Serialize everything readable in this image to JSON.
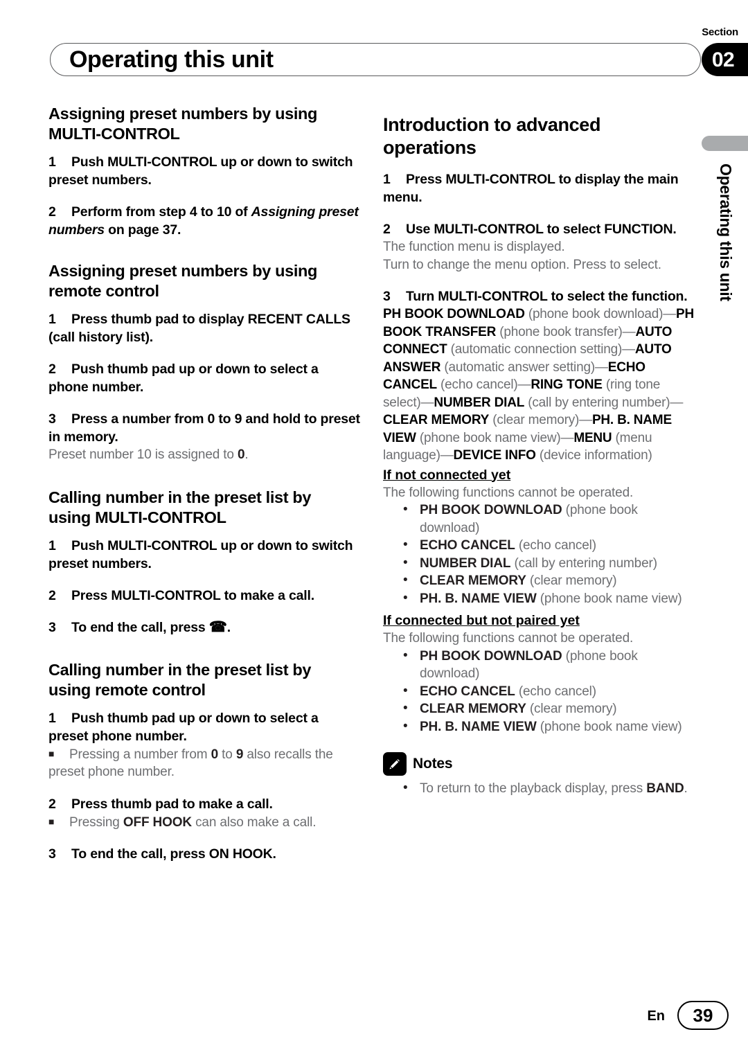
{
  "header": {
    "title": "Operating this unit",
    "section_label": "Section",
    "section_number": "02"
  },
  "thumb_tab": {
    "label": "Operating this unit",
    "color": "#a9abad"
  },
  "left_column": {
    "section1": {
      "heading_line1": "Assigning preset numbers by using",
      "heading_line2": "MULTI-CONTROL",
      "steps": [
        {
          "num": "1",
          "text": "Push MULTI-CONTROL up or down to switch preset numbers."
        },
        {
          "num": "2",
          "text_pre": "Perform from step 4 to 10 of ",
          "text_italic": "Assigning preset numbers",
          "text_post": " on page 37."
        }
      ]
    },
    "section2": {
      "heading_line1": "Assigning preset numbers by using",
      "heading_line2": "remote control",
      "steps": [
        {
          "num": "1",
          "text": "Press thumb pad to display RECENT CALLS (call history list)."
        },
        {
          "num": "2",
          "text": "Push thumb pad up or down to select a phone number."
        },
        {
          "num": "3",
          "text": "Press a number from 0 to 9 and hold to preset in memory."
        }
      ],
      "note_pre": "Preset number 10 is assigned to ",
      "note_bold": "0",
      "note_post": "."
    },
    "section3": {
      "heading_line1": "Calling number in the preset list by",
      "heading_line2_bold": "using ",
      "heading_line2_rest": "MULTI-CONTROL",
      "steps": [
        {
          "num": "1",
          "text": "Push MULTI-CONTROL up or down to switch preset numbers."
        },
        {
          "num": "2",
          "text": "Press MULTI-CONTROL to make a call."
        },
        {
          "num": "3",
          "text_pre": "To end the call, press ",
          "icon": "telephone-icon",
          "icon_glyph": "☎",
          "text_post": "."
        }
      ]
    },
    "section4": {
      "heading_line1": "Calling number in the preset list by",
      "heading_line2": "using remote control",
      "step1": {
        "num": "1",
        "text": "Push thumb pad up or down to select a preset phone number."
      },
      "step1_bullet_pre": "Pressing a number from ",
      "step1_bullet_b1": "0",
      "step1_bullet_mid": " to ",
      "step1_bullet_b2": "9",
      "step1_bullet_post": " also recalls the preset phone number.",
      "step2": {
        "num": "2",
        "text": "Press thumb pad to make a call."
      },
      "step2_bullet_pre": "Pressing ",
      "step2_bullet_bold": "OFF HOOK",
      "step2_bullet_post": " can also make a call.",
      "step3": {
        "num": "3",
        "text": "To end the call, press ON HOOK."
      }
    }
  },
  "right_column": {
    "heading_line1": "Introduction to advanced",
    "heading_line2": "operations",
    "step1": {
      "num": "1",
      "text": "Press MULTI-CONTROL to display the main menu."
    },
    "step2": {
      "num": "2",
      "text": "Use MULTI-CONTROL to select FUNCTION."
    },
    "step2_notes": [
      "The function menu is displayed.",
      "Turn to change the menu option. Press to select."
    ],
    "step3": {
      "num": "3",
      "text": "Turn MULTI-CONTROL to select the function."
    },
    "function_chain": [
      {
        "bold": "PH BOOK DOWNLOAD",
        "plain": " (phone book download)—"
      },
      {
        "bold": "PH BOOK TRANSFER",
        "plain": " (phone book transfer)—"
      },
      {
        "bold": "AUTO CONNECT",
        "plain": " (automatic connection setting)—"
      },
      {
        "bold": "AUTO ANSWER",
        "plain": " (automatic answer setting)—"
      },
      {
        "bold": "ECHO CANCEL",
        "plain": " (echo cancel)—"
      },
      {
        "bold": "RING TONE",
        "plain": " (ring tone select)—"
      },
      {
        "bold": "NUMBER DIAL",
        "plain": " (call by entering number)—"
      },
      {
        "bold": "CLEAR MEMORY",
        "plain": " (clear memory)—"
      },
      {
        "bold": "PH. B. NAME VIEW",
        "plain": " (phone book name view)—"
      },
      {
        "bold": "MENU",
        "plain": " (menu language)—"
      },
      {
        "bold": "DEVICE INFO",
        "plain": " (device information)"
      }
    ],
    "not_connected": {
      "title": "If not connected yet",
      "intro": "The following functions cannot be operated.",
      "items": [
        {
          "bold": "PH BOOK DOWNLOAD",
          "plain": " (phone book download)"
        },
        {
          "bold": "ECHO CANCEL",
          "plain": " (echo cancel)"
        },
        {
          "bold": "NUMBER DIAL",
          "plain": " (call by entering number)"
        },
        {
          "bold": "CLEAR MEMORY",
          "plain": " (clear memory)"
        },
        {
          "bold": "PH. B. NAME VIEW",
          "plain": " (phone book name view)"
        }
      ]
    },
    "not_paired": {
      "title": "If connected but not paired yet",
      "intro": "The following functions cannot be operated.",
      "items": [
        {
          "bold": "PH BOOK DOWNLOAD",
          "plain": " (phone book download)"
        },
        {
          "bold": "ECHO CANCEL",
          "plain": " (echo cancel)"
        },
        {
          "bold": "CLEAR MEMORY",
          "plain": " (clear memory)"
        },
        {
          "bold": "PH. B. NAME VIEW",
          "plain": " (phone book name view)"
        }
      ]
    },
    "notes": {
      "icon": "pencil-icon",
      "title": "Notes",
      "items": [
        {
          "pre": "To return to the playback display, press ",
          "bold": "BAND",
          "post": "."
        }
      ]
    }
  },
  "footer": {
    "language": "En",
    "page_number": "39"
  }
}
